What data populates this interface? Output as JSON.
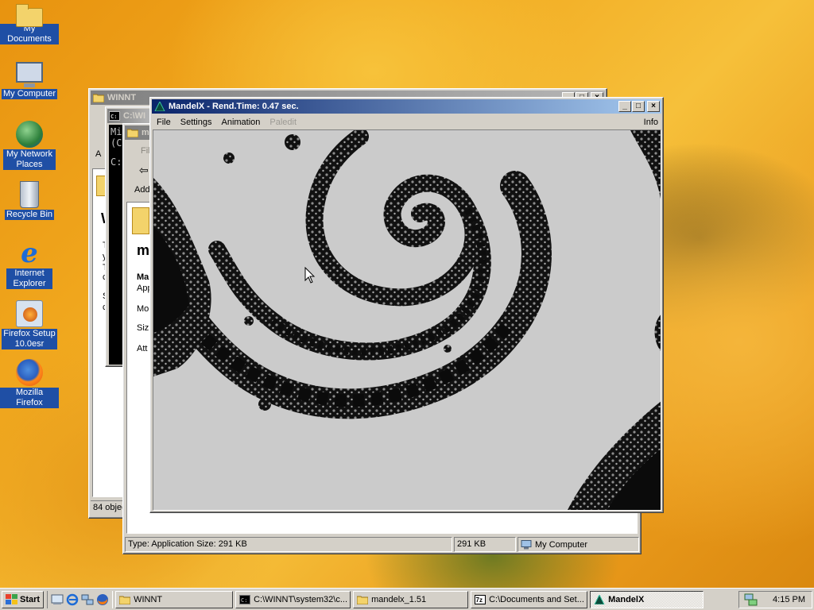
{
  "desktop": {
    "icons": [
      {
        "label": "My Documents",
        "icon": "my-documents-icon"
      },
      {
        "label": "My Computer",
        "icon": "my-computer-icon"
      },
      {
        "label": "My Network Places",
        "icon": "network-places-icon"
      },
      {
        "label": "Recycle Bin",
        "icon": "recycle-bin-icon"
      },
      {
        "label": "Internet Explorer",
        "icon": "internet-explorer-icon"
      },
      {
        "label": "Firefox Setup 10.0esr",
        "icon": "firefox-setup-icon"
      },
      {
        "label": "Mozilla Firefox",
        "icon": "firefox-icon"
      }
    ]
  },
  "winnt_window": {
    "title": "WINNT",
    "status_left": "84 objec",
    "letters": [
      "T",
      "y",
      "T",
      "c",
      "S",
      "c"
    ]
  },
  "cmd_window": {
    "title": "C:\\WI",
    "lines": [
      "Mi",
      "(C",
      "C:"
    ]
  },
  "mandelx_folder_window": {
    "title": "m",
    "menu_partial": "Fil",
    "address_partial": "Add",
    "heading": "m",
    "details": {
      "name": "Ma",
      "type": "App",
      "modified": "Mo",
      "size": "Siz",
      "attributes": "Att"
    },
    "status": {
      "info": "Type: Application Size: 291 KB",
      "size": "291 KB",
      "zone": "My Computer"
    }
  },
  "mandelx_app": {
    "title": "MandelX - Rend.Time:  0.47 sec.",
    "menu": [
      "File",
      "Settings",
      "Animation",
      "Paledit"
    ],
    "menu_right": "Info",
    "disabled_menu": "Paledit"
  },
  "taskbar": {
    "start_label": "Start",
    "quick_launch": [
      "show-desktop-icon",
      "internet-explorer-icon",
      "network-icon",
      "firefox-icon"
    ],
    "tasks": [
      {
        "label": "WINNT",
        "icon": "folder-icon",
        "active": false
      },
      {
        "label": "C:\\WINNT\\system32\\c...",
        "icon": "cmd-icon",
        "active": false
      },
      {
        "label": "mandelx_1.51",
        "icon": "folder-icon",
        "active": false
      },
      {
        "label": "C:\\Documents and Set...",
        "icon": "7zip-icon",
        "active": false
      },
      {
        "label": "MandelX",
        "icon": "mandelx-icon",
        "active": true
      }
    ],
    "clock": "4:15 PM"
  },
  "colors": {
    "active_title": "#0a246a",
    "desktop_label_bg": "#1f4fa5",
    "face": "#d4d0c8"
  }
}
